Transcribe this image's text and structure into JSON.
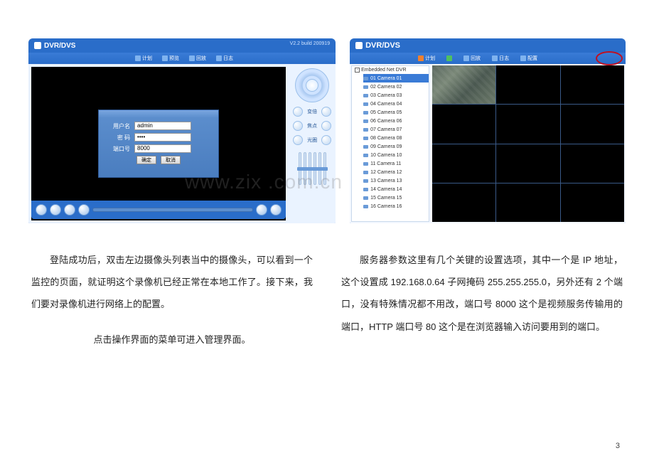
{
  "watermark": "www.zix    .com.cn",
  "page_number": "3",
  "left_app": {
    "title": "DVR/DVS",
    "version": "V2.2  build 200919",
    "toolbar": {
      "i1": "计划",
      "i2": "预览",
      "i3": "回放",
      "i4": "日志"
    },
    "login": {
      "user_label": "用户名",
      "user_value": "admin",
      "pass_label": "密  码",
      "pass_value": "••••",
      "port_label": "端口号",
      "port_value": "8000",
      "ok": "确定",
      "cancel": "取消"
    },
    "side_labels": {
      "zoom": "变倍",
      "focus": "焦点",
      "iris": "光圈"
    }
  },
  "right_app": {
    "title": "DVR/DVS",
    "toolbar": {
      "i1": "计划",
      "i2": "回放",
      "i3": "日志",
      "i4": "配置"
    },
    "tree_root": "Embedded Net DVR",
    "cams": [
      "01 Camera 01",
      "02 Camera 02",
      "03 Camera 03",
      "04 Camera 04",
      "05 Camera 05",
      "06 Camera 06",
      "07 Camera 07",
      "08 Camera 08",
      "09 Camera 09",
      "10 Camera 10",
      "11 Camera 11",
      "12 Camera 12",
      "13 Camera 13",
      "14 Camera 14",
      "15 Camera 15",
      "16 Camera 16"
    ]
  },
  "text": {
    "left_p1": "登陆成功后，双击左边摄像头列表当中的摄像头，可以看到一个监控的页面，就证明这个录像机已经正常在本地工作了。接下来，我们要对录像机进行网络上的配置。",
    "left_p2": "点击操作界面的菜单可进入管理界面。",
    "right_p1": "服务器参数这里有几个关键的设置选项，其中一个是 IP 地址，这个设置成 192.168.0.64 子网掩码 255.255.255.0，另外还有 2 个端口，没有特殊情况都不用改，端口号 8000 这个是视频服务传输用的端口，HTTP 端口号 80 这个是在浏览器输入访问要用到的端口。"
  }
}
